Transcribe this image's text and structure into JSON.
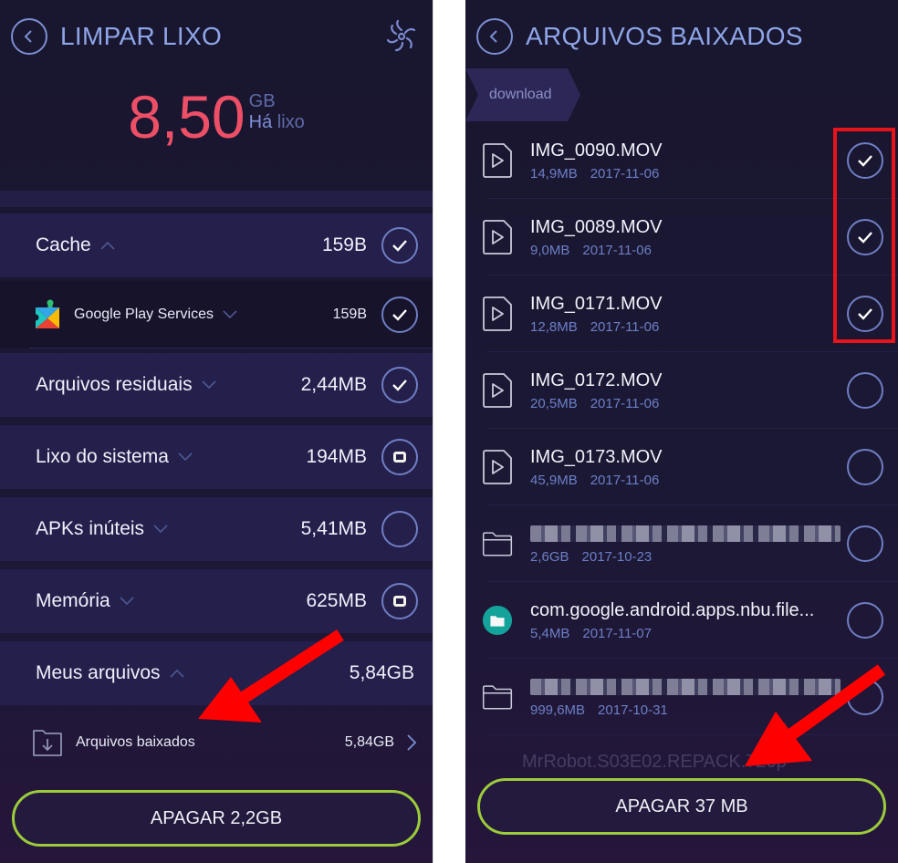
{
  "left_screen": {
    "title": "LIMPAR LIXO",
    "icons": {
      "back": "back-arrow-icon",
      "action": "fan-turbo-icon"
    },
    "summary": {
      "amount": "8,50",
      "unit": "GB",
      "label_prefix": "Há",
      "label_suffix": " lixo"
    },
    "categories": [
      {
        "label": "Cache",
        "size": "159B",
        "expanded": true,
        "state": "checked"
      },
      {
        "label": "Arquivos residuais",
        "size": "2,44MB",
        "expanded": false,
        "state": "checked"
      },
      {
        "label": "Lixo do sistema",
        "size": "194MB",
        "expanded": false,
        "state": "partial"
      },
      {
        "label": "APKs inúteis",
        "size": "5,41MB",
        "expanded": false,
        "state": "unchecked"
      },
      {
        "label": "Memória",
        "size": "625MB",
        "expanded": false,
        "state": "partial"
      },
      {
        "label": "Meus arquivos",
        "size": "5,84GB",
        "expanded": true,
        "state": "none"
      }
    ],
    "cache_child": {
      "label": "Google Play Services",
      "size": "159B",
      "state": "checked",
      "icon": "google-play-services-icon"
    },
    "files_child": {
      "label": "Arquivos baixados",
      "size": "5,84GB",
      "icon": "download-folder-icon"
    },
    "cta_label": "APAGAR 2,2GB"
  },
  "right_screen": {
    "title": "ARQUIVOS BAIXADOS",
    "breadcrumb": "download",
    "files": [
      {
        "name": "IMG_0090.MOV",
        "size": "14,9MB",
        "date": "2017-11-06",
        "type": "video",
        "checked": true
      },
      {
        "name": "IMG_0089.MOV",
        "size": "9,0MB",
        "date": "2017-11-06",
        "type": "video",
        "checked": true
      },
      {
        "name": "IMG_0171.MOV",
        "size": "12,8MB",
        "date": "2017-11-06",
        "type": "video",
        "checked": true
      },
      {
        "name": "IMG_0172.MOV",
        "size": "20,5MB",
        "date": "2017-11-06",
        "type": "video",
        "checked": false
      },
      {
        "name": "IMG_0173.MOV",
        "size": "45,9MB",
        "date": "2017-11-06",
        "type": "video",
        "checked": false
      },
      {
        "name": "",
        "size": "2,6GB",
        "date": "2017-10-23",
        "type": "folder",
        "checked": false,
        "name_blurred": true
      },
      {
        "name": "com.google.android.apps.nbu.file...",
        "size": "5,4MB",
        "date": "2017-11-07",
        "type": "app",
        "checked": false
      },
      {
        "name": "",
        "size": "999,6MB",
        "date": "2017-10-31",
        "type": "folder",
        "checked": false,
        "name_blurred": true
      }
    ],
    "partial_file_name": "MrRobot.S03E02.REPACK.720p",
    "cta_label": "APAGAR 37 MB"
  },
  "annotations": {
    "color": "#e8141b",
    "highlight": "selected-checkboxes"
  },
  "colors": {
    "accent_red": "#ec4f66",
    "accent_blue": "#8ea6e8",
    "button_border": "#9ccb3b",
    "panel_bg": "#1b1835"
  }
}
